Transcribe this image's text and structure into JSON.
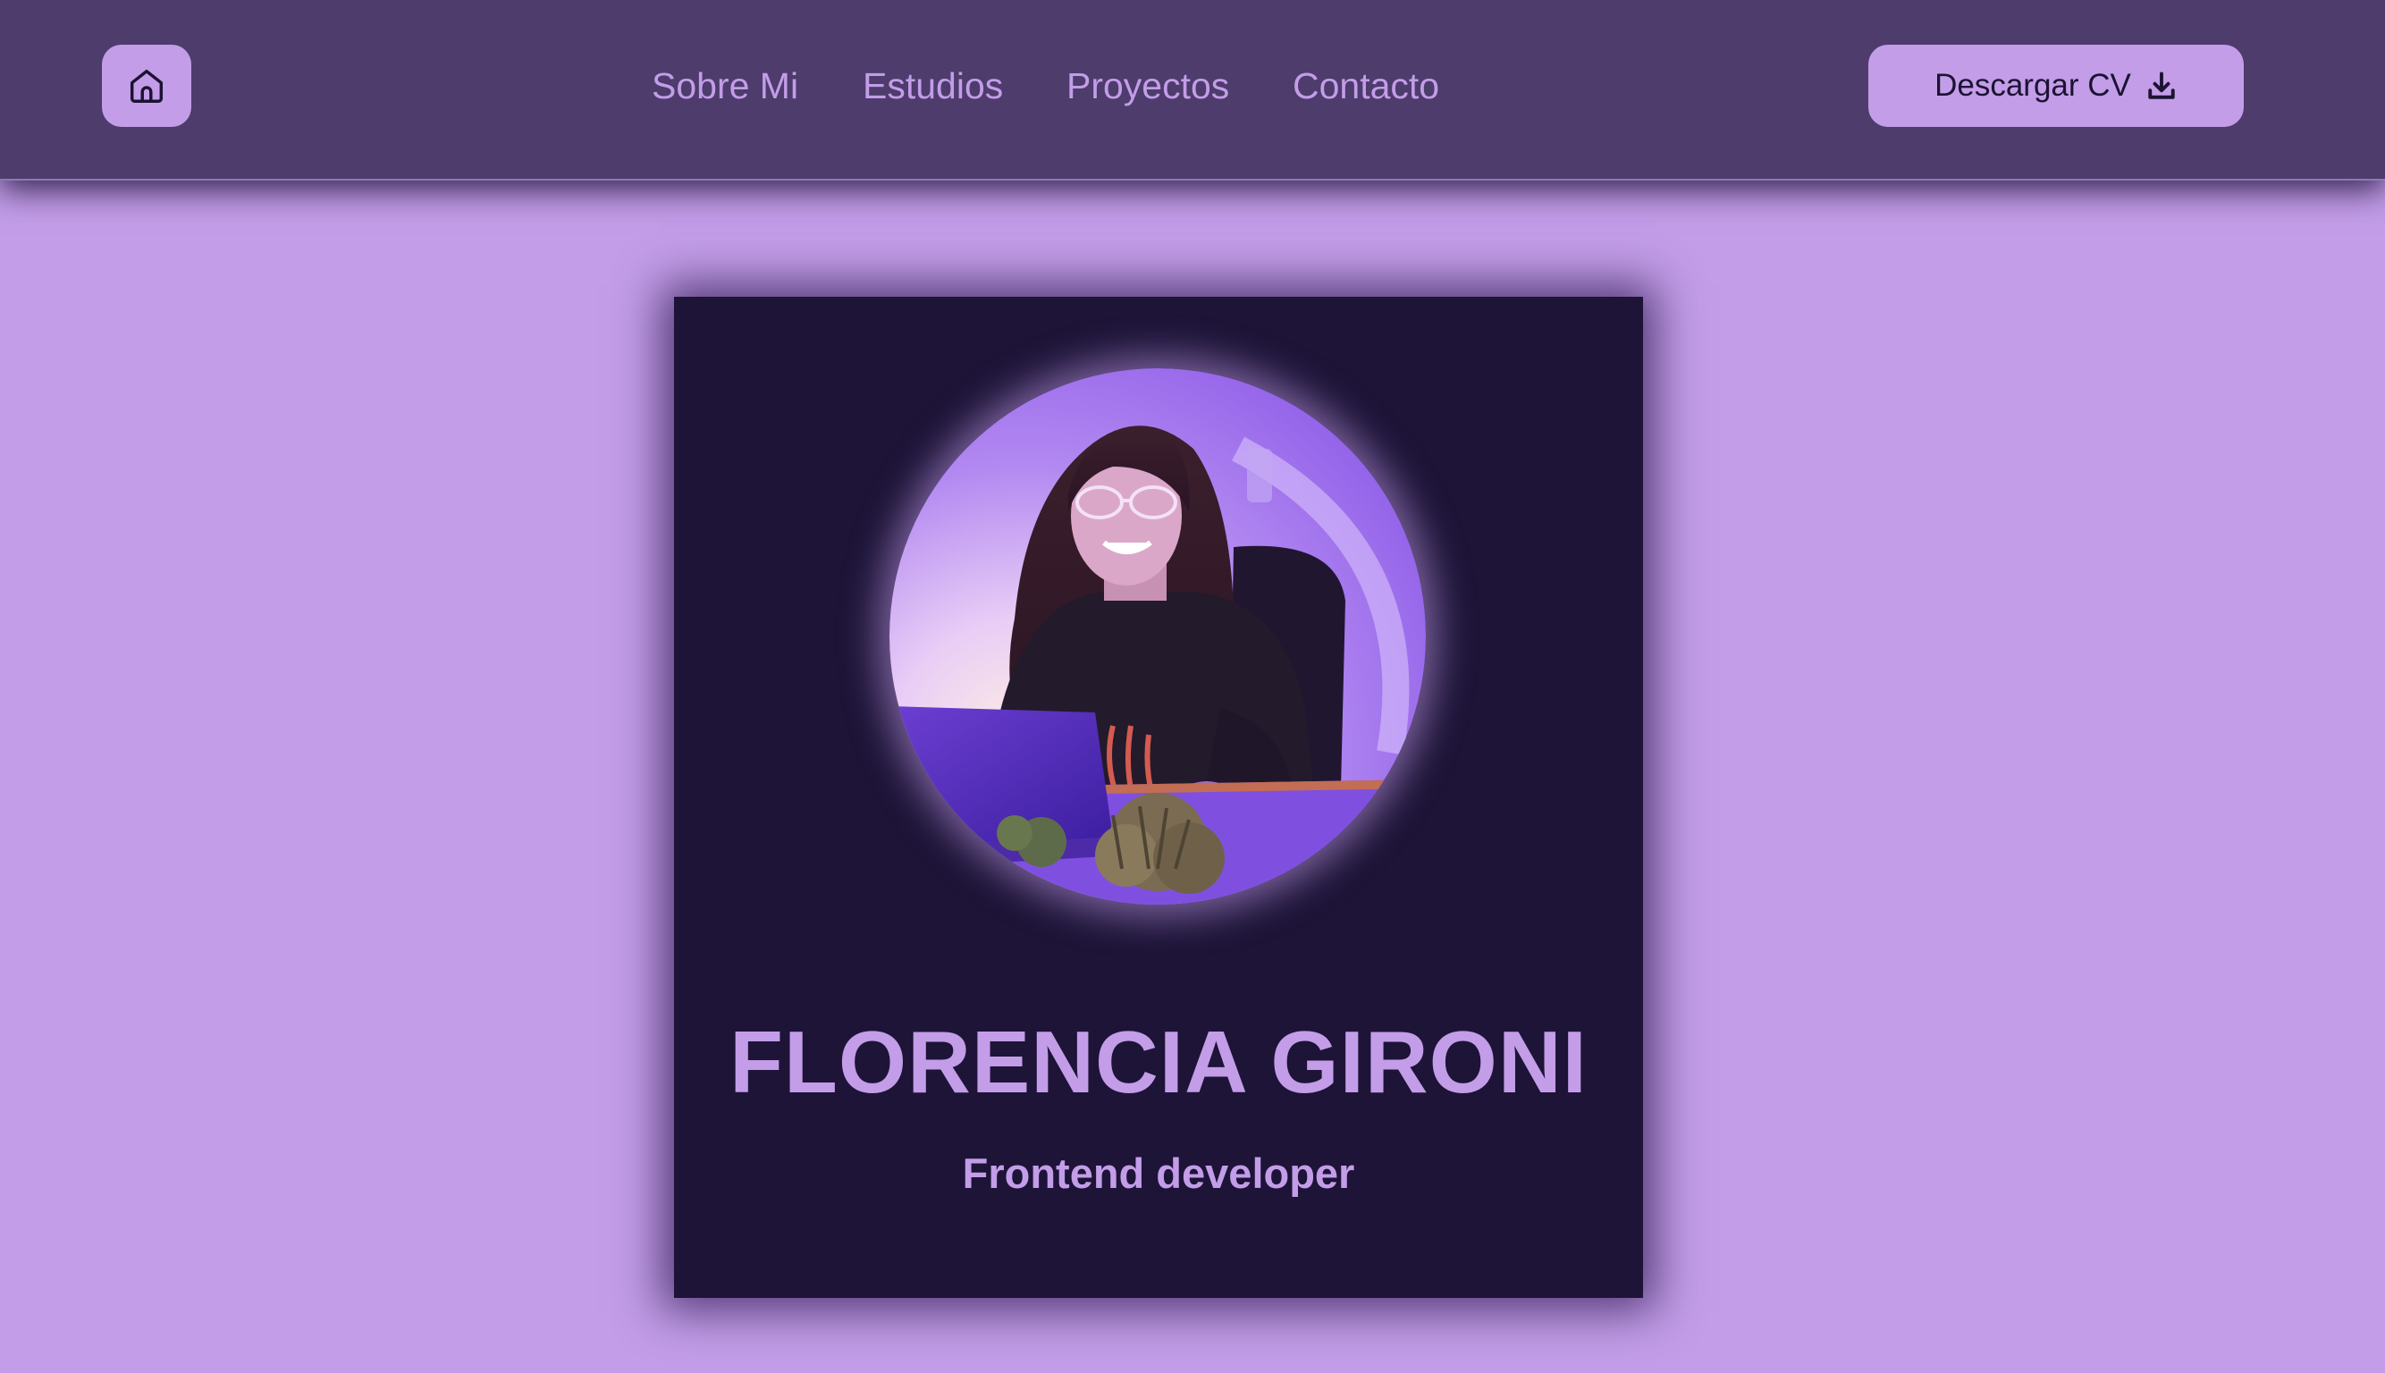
{
  "header": {
    "home_icon": "home-icon",
    "nav": [
      {
        "label": "Sobre Mi"
      },
      {
        "label": "Estudios"
      },
      {
        "label": "Proyectos"
      },
      {
        "label": "Contacto"
      }
    ],
    "download_cv": {
      "label": "Descargar CV",
      "icon": "download-icon"
    }
  },
  "hero": {
    "name": "FLORENCIA GIRONI",
    "role": "Frontend developer"
  },
  "colors": {
    "navbar_bg": "#4d3c6c",
    "page_bg": "#c39de8",
    "card_bg": "#1d1438",
    "accent": "#c39de8",
    "button_text": "#1c1333"
  }
}
